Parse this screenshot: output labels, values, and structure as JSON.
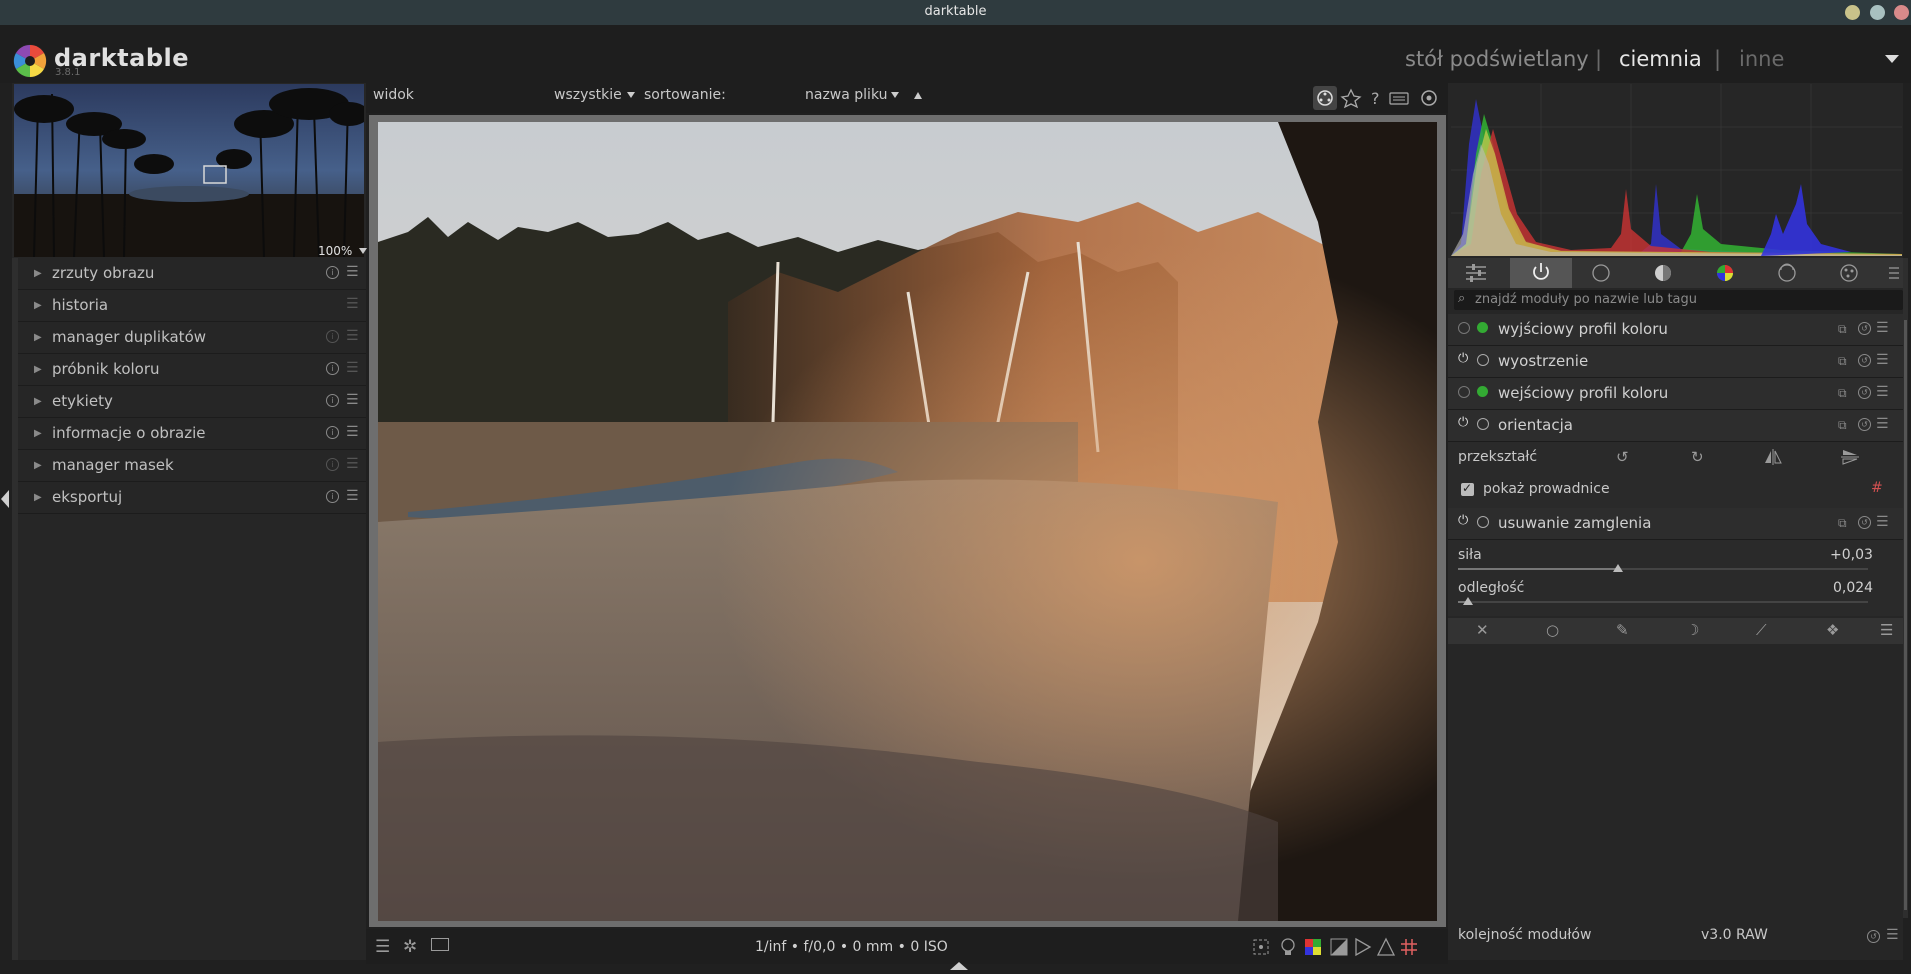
{
  "window": {
    "title": "darktable"
  },
  "header": {
    "app_name": "darktable",
    "version": "3.8.1",
    "views": [
      "stół podświetlany",
      "ciemnia",
      "inne"
    ],
    "separator": "|",
    "active_view": "ciemnia"
  },
  "navigation": {
    "zoom": "100%"
  },
  "left_modules": [
    {
      "label": "zrzuty obrazu"
    },
    {
      "label": "historia"
    },
    {
      "label": "manager duplikatów"
    },
    {
      "label": "próbnik koloru"
    },
    {
      "label": "etykiety"
    },
    {
      "label": "informacje o obrazie"
    },
    {
      "label": "manager masek"
    },
    {
      "label": "eksportuj"
    }
  ],
  "filter_bar": {
    "view_label": "widok",
    "filter_value": "wszystkie",
    "sort_label": "sortowanie:",
    "sort_value": "nazwa pliku"
  },
  "image_info": "1/inf • f/0,0 • 0 mm • 0 ISO",
  "right_panel": {
    "search_placeholder": "znajdź moduły po nazwie lub tagu",
    "modules": [
      {
        "label": "wyjściowy profil koloru"
      },
      {
        "label": "wyostrzenie"
      },
      {
        "label": "wejściowy profil koloru"
      },
      {
        "label": "orientacja"
      }
    ],
    "orientation": {
      "transform_label": "przekształć",
      "guides_label": "pokaż prowadnice",
      "guides_checked": true
    },
    "haze": {
      "label": "usuwanie zamglenia",
      "strength_label": "siła",
      "strength_value": "+0,03",
      "strength_level": 0.39,
      "distance_label": "odległość",
      "distance_value": "0,024",
      "distance_level": 0.024
    },
    "module_order_label": "kolejność modułów",
    "module_order_value": "v3.0 RAW"
  },
  "colors": {
    "panel": "#262626",
    "background": "#202020",
    "text": "#c0c0c0",
    "titlebar": "#2f3b3f"
  }
}
